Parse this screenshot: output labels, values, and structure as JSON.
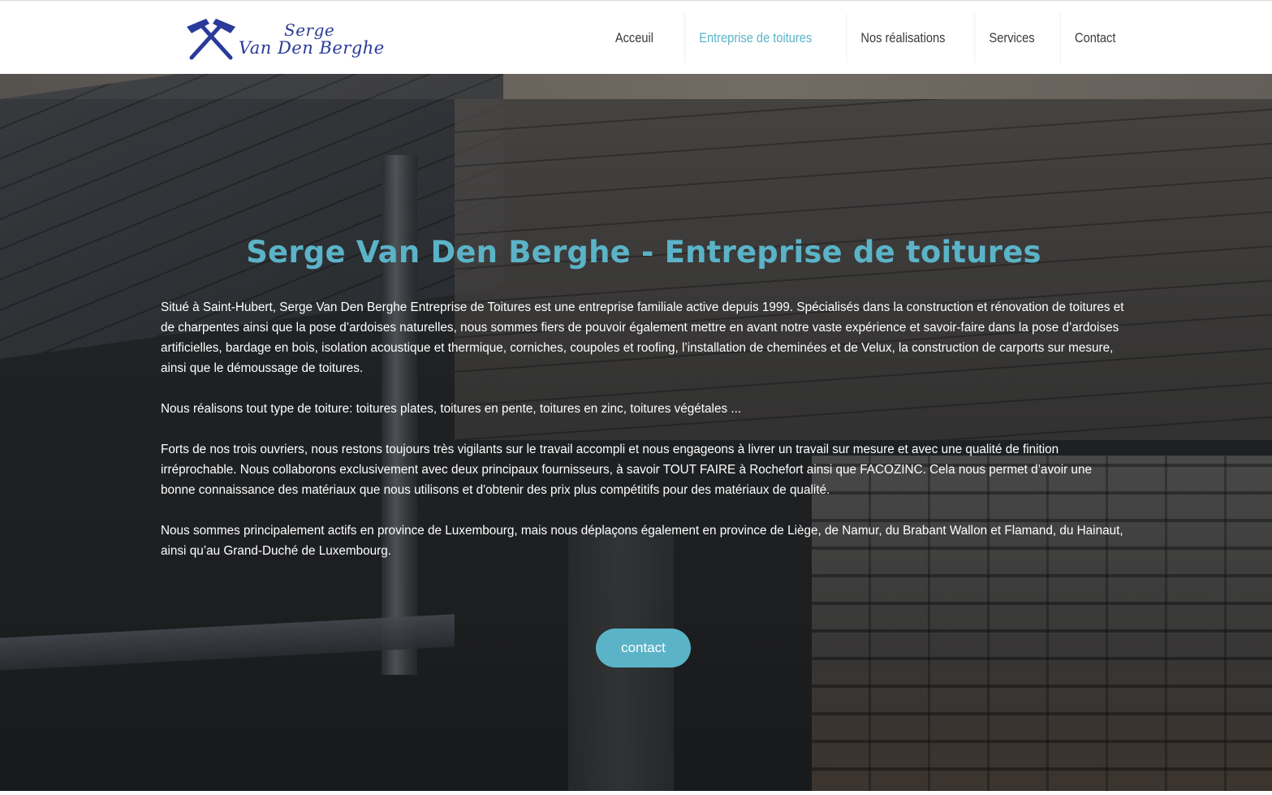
{
  "brand": {
    "line1": "Serge",
    "line2": "Van Den Berghe",
    "logo_icon": "crossed-roofing-hammers-icon",
    "color": "#2a3a9a"
  },
  "nav": {
    "items": [
      {
        "label": "Acceuil",
        "active": false
      },
      {
        "label": "Entreprise de toitures",
        "active": true
      },
      {
        "label": "Nos réalisations",
        "active": false
      },
      {
        "label": "Services",
        "active": false
      },
      {
        "label": "Contact",
        "active": false
      }
    ]
  },
  "hero": {
    "title": "Serge Van Den Berghe - Entreprise de toitures",
    "paragraphs": [
      "Situé à Saint-Hubert, Serge Van Den Berghe Entreprise de Toitures est une entreprise familiale active depuis 1999. Spécialisés dans la construction et rénovation de toitures et de charpentes ainsi que la pose d’ardoises naturelles, nous sommes fiers de pouvoir également mettre en avant notre vaste expérience et savoir-faire dans la pose d’ardoises artificielles, bardage en bois, isolation acoustique et thermique, corniches, coupoles et roofing, l’installation de cheminées et de Velux, la construction de carports sur mesure, ainsi que le démoussage de toitures.",
      "Nous réalisons tout type de toiture: toitures plates, toitures en pente, toitures en zinc, toitures végétales ...",
      "Forts de nos trois ouvriers, nous restons toujours très vigilants sur le travail accompli et nous engageons à livrer un travail sur mesure et avec une qualité de finition irréprochable. Nous collaborons exclusivement avec deux principaux fournisseurs, à savoir TOUT FAIRE à Rochefort ainsi que FACOZINC. Cela nous permet d’avoir une bonne connaissance des matériaux que nous utilisons et d'obtenir des prix plus compétitifs pour des matériaux de qualité.",
      "Nous sommes principalement actifs en province de Luxembourg, mais nous déplaçons également en province de Liège, de Namur, du Brabant Wallon et Flamand, du Hainaut, ainsi qu’au Grand-Duché de Luxembourg."
    ],
    "button_label": "contact"
  },
  "colors": {
    "accent": "#5bb3c8",
    "nav_text": "#3a3a3a",
    "body_text": "#ffffff"
  }
}
